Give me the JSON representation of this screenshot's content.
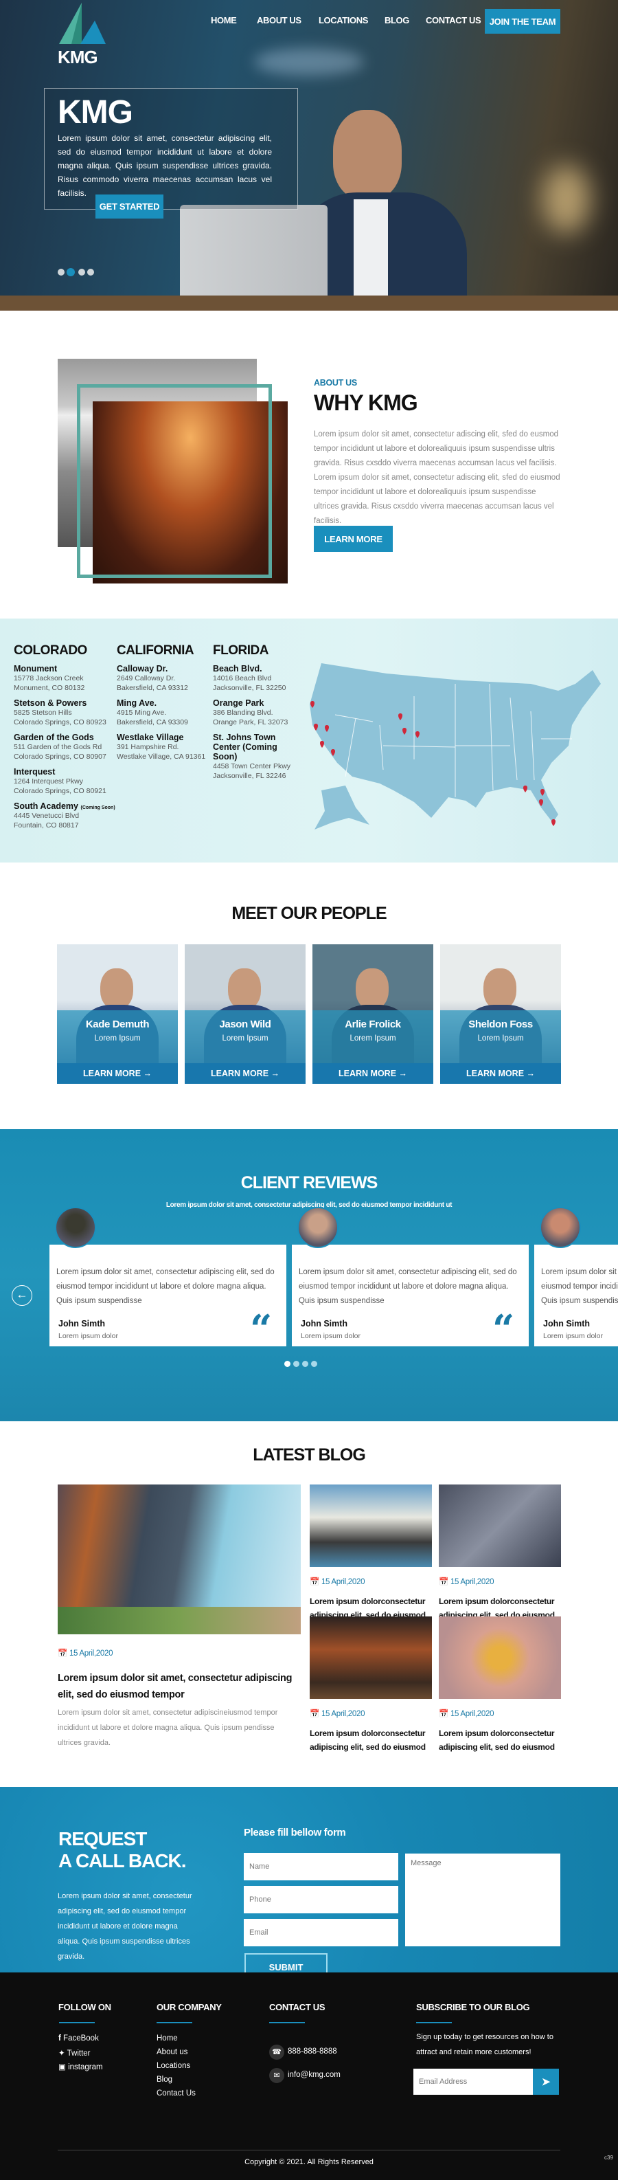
{
  "brand": {
    "logo_text": "KMG",
    "accent": "#1a8fbd",
    "dark": "#0d0d0d",
    "pin": "#d0283a"
  },
  "nav": {
    "items": [
      "HOME",
      "ABOUT US",
      "LOCATIONS",
      "BLOG",
      "CONTACT US"
    ],
    "cta": "JOIN THE TEAM"
  },
  "hero": {
    "title": "KMG",
    "text": "Lorem ipsum dolor sit amet, consectetur adipiscing elit, sed do eiusmod tempor incididunt ut labore et dolore magna aliqua. Quis ipsum suspendisse ultrices gravida. Risus commodo viverra maecenas accumsan lacus vel facilisis.",
    "button": "GET STARTED",
    "slides": 4,
    "active_slide": 2
  },
  "about": {
    "eyebrow": "ABOUT US",
    "title": "WHY KMG",
    "text": "Lorem ipsum dolor sit amet, consectetur adiscing elit, sfed do eusmod tempor incididunt ut labore et dolorealiquuis ipsum suspendisse ultris gravida. Risus cxsddo viverra maecenas accumsan lacus vel facilisis. Lorem ipsum dolor sit amet, consectetur adiscing elit, sfed do eiusmod tempor incididunt ut labore et dolorealiquuis ipsum suspendisse ultrices gravida. Risus cxsddo viverra maecenas accumsan lacus vel facilisis.",
    "button": "LEARN MORE"
  },
  "locations": {
    "states": [
      {
        "name": "COLORADO",
        "sites": [
          {
            "name": "Monument",
            "line1": "15778 Jackson Creek",
            "line2": "Monument, CO 80132"
          },
          {
            "name": "Stetson & Powers",
            "line1": "5825 Stetson Hills",
            "line2": "Colorado Springs, CO 80923"
          },
          {
            "name": "Garden of the Gods",
            "line1": "511 Garden of the Gods Rd",
            "line2": "Colorado Springs, CO 80907"
          },
          {
            "name": "Interquest",
            "line1": "1264 Interquest Pkwy",
            "line2": "Colorado Springs, CO 80921"
          },
          {
            "name": "South Academy",
            "note": "(Coming Soon)",
            "line1": "4445 Venetucci Blvd",
            "line2": "Fountain, CO 80817"
          }
        ]
      },
      {
        "name": "CALIFORNIA",
        "sites": [
          {
            "name": "Calloway Dr.",
            "line1": "2649 Calloway Dr.",
            "line2": "Bakersfield, CA 93312"
          },
          {
            "name": "Ming Ave.",
            "line1": "4915 Ming Ave.",
            "line2": "Bakersfield, CA 93309"
          },
          {
            "name": "Westlake Village",
            "line1": "391 Hampshire Rd.",
            "line2": "Westlake Village, CA 91361"
          }
        ]
      },
      {
        "name": "FLORIDA",
        "sites": [
          {
            "name": "Beach Blvd.",
            "line1": "14016 Beach Blvd",
            "line2": "Jacksonville, FL 32250"
          },
          {
            "name": "Orange Park",
            "line1": "386 Blanding Blvd.",
            "line2": "Orange Park, FL 32073"
          },
          {
            "name": "St. Johns Town Center (Coming Soon)",
            "line1": "4458 Town Center Pkwy",
            "line2": "Jacksonville, FL 32246"
          }
        ]
      }
    ]
  },
  "people": {
    "title": "MEET OUR PEOPLE",
    "members": [
      {
        "name": "Kade Demuth",
        "role": "Lorem Ipsum",
        "link": "LEARN MORE →"
      },
      {
        "name": "Jason Wild",
        "role": "Lorem Ipsum",
        "link": "LEARN MORE →"
      },
      {
        "name": "Arlie Frolick",
        "role": "Lorem Ipsum",
        "link": "LEARN MORE →"
      },
      {
        "name": "Sheldon Foss",
        "role": "Lorem Ipsum",
        "link": "LEARN MORE →"
      }
    ]
  },
  "reviews": {
    "title": "CLIENT REVIEWS",
    "subtitle": "Lorem ipsum dolor sit amet, consectetur adipiscing elit, sed do eiusmod tempor incididunt ut",
    "items": [
      {
        "text": "Lorem ipsum dolor sit amet, consectetur adipiscing elit, sed do eiusmod tempor incididunt ut labore et dolore magna aliqua. Quis ipsum suspendisse",
        "name": "John Simth",
        "sub": "Lorem ipsum dolor"
      },
      {
        "text": "Lorem ipsum dolor sit amet, consectetur adipiscing elit, sed do eiusmod tempor incididunt ut labore et dolore magna aliqua. Quis ipsum suspendisse",
        "name": "John Simth",
        "sub": "Lorem ipsum dolor"
      },
      {
        "text": "Lorem ipsum dolor sit amet, consectetur adipiscing elit, sed do eiusmod tempor incididunt ut labore et dolore magna aliqua. Quis ipsum suspendisse",
        "name": "John Simth",
        "sub": "Lorem ipsum dolor"
      }
    ],
    "quote_glyph": "“",
    "prev_icon": "←",
    "dots": 4,
    "active_dot": 1
  },
  "blog": {
    "title": "LATEST BLOG",
    "featured": {
      "date": "15 April,2020",
      "title": "Lorem ipsum dolor sit amet, consectetur adipiscing elit, sed do eiusmod tempor",
      "text": "Lorem ipsum dolor sit amet, consectetur adipiscineiusmod tempor incididunt ut labore et dolore magna aliqua. Quis ipsum pendisse ultrices gravida."
    },
    "posts": [
      {
        "date": "15 April,2020",
        "title": "Lorem ipsum dolorconsectetur adipiscing elit, sed do eiusmod"
      },
      {
        "date": "15 April,2020",
        "title": "Lorem ipsum dolorconsectetur adipiscing elit, sed do eiusmod"
      },
      {
        "date": "15 April,2020",
        "title": "Lorem ipsum dolorconsectetur adipiscing elit, sed do eiusmod"
      },
      {
        "date": "15 April,2020",
        "title": "Lorem ipsum dolorconsectetur adipiscing elit, sed do eiusmod"
      }
    ]
  },
  "callback": {
    "title1": "REQUEST",
    "title2": "A CALL BACK.",
    "text": "Lorem ipsum dolor sit amet, consectetur adipiscing elit, sed do eiusmod tempor incididunt ut labore et dolore magna aliqua. Quis ipsum suspendisse ultrices gravida.",
    "form_title": "Please fill bellow form",
    "name_ph": "Name",
    "phone_ph": "Phone",
    "email_ph": "Email",
    "message_ph": "Message",
    "submit": "SUBMIT"
  },
  "footer": {
    "follow": {
      "title": "FOLLOW ON",
      "links": [
        "FaceBook",
        "Twitter",
        "instagram"
      ]
    },
    "company": {
      "title": "OUR COMPANY",
      "links": [
        "Home",
        "About us",
        "Locations",
        "Blog",
        "Contact Us"
      ]
    },
    "contact": {
      "title": "CONTACT US",
      "phone": "888-888-8888",
      "email": "info@kmg.com"
    },
    "subscribe": {
      "title": "SUBSCRIBE TO OUR BLOG",
      "text": "Sign up today to get resources on how to attract and retain more customers!",
      "placeholder": "Email Address"
    },
    "copyright": "Copyright © 2021. All Rights Reserved",
    "corner": "c39"
  }
}
